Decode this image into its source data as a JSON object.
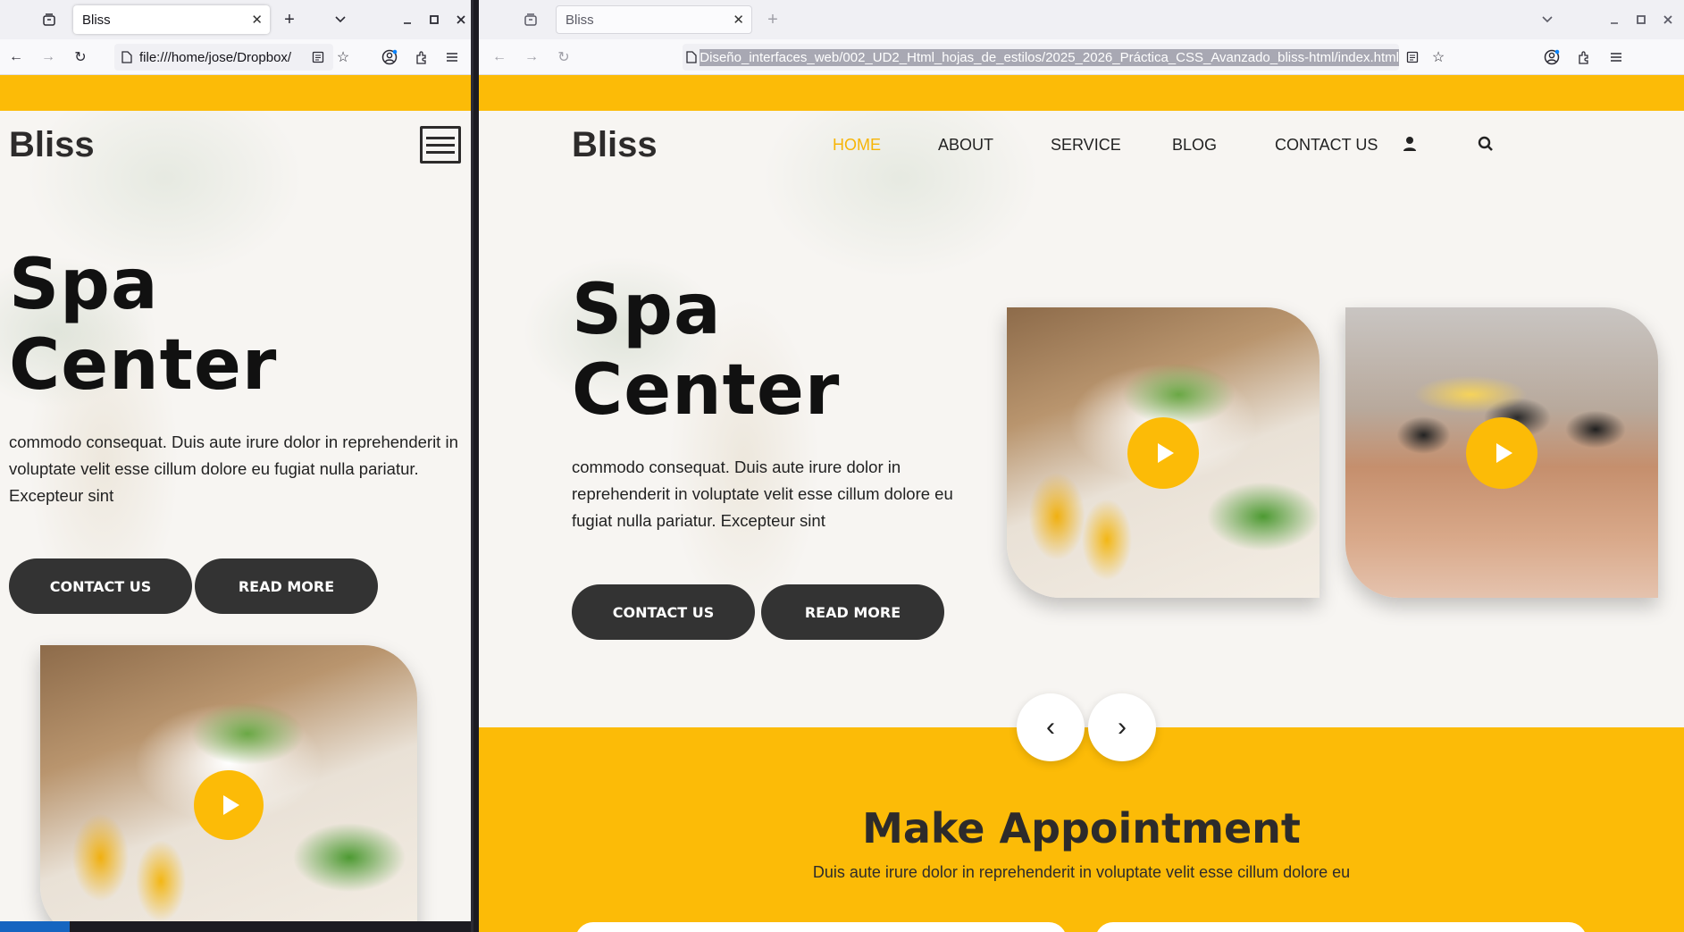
{
  "left_window": {
    "tab_title": "Bliss",
    "url": "file:///home/jose/Dropbox/",
    "logo": "Bliss",
    "hero_line1": "Spa",
    "hero_line2": "Center",
    "hero_text": "commodo consequat. Duis aute irure dolor in reprehenderit in voluptate velit esse cillum dolore eu fugiat nulla pariatur. Excepteur sint",
    "btn_contact": "CONTACT US",
    "btn_read": "READ MORE"
  },
  "right_window": {
    "tab_title": "Bliss",
    "url": "Diseño_interfaces_web/002_UD2_Html_hojas_de_estilos/2025_2026_Práctica_CSS_Avanzado_bliss-html/index.html",
    "logo": "Bliss",
    "nav": [
      "HOME",
      "ABOUT",
      "SERVICE",
      "BLOG",
      "CONTACT US"
    ],
    "hero_line1": "Spa",
    "hero_line2": "Center",
    "hero_text": "commodo consequat. Duis aute irure dolor in reprehenderit in voluptate velit esse cillum dolore eu fugiat nulla pariatur. Excepteur sint",
    "btn_contact": "CONTACT US",
    "btn_read": "READ MORE",
    "prev_arrow": "‹",
    "next_arrow": "›",
    "appointment_title": "Make Appointment",
    "appointment_subtitle": "Duis aute irure dolor in reprehenderit in voluptate velit esse cillum dolore eu"
  },
  "colors": {
    "accent": "#fcbb07",
    "dark_button": "#333333",
    "active_nav": "#f7b506"
  },
  "icons": [
    "tab-list-icon",
    "new-tab-icon",
    "tab-overflow-icon",
    "minimize-icon",
    "maximize-icon",
    "close-window-icon",
    "back-icon",
    "forward-icon",
    "reload-icon",
    "page-icon",
    "reader-mode-icon",
    "bookmark-star-icon",
    "account-icon",
    "extensions-icon",
    "menu-icon",
    "user-icon",
    "search-icon",
    "play-icon",
    "hamburger-icon"
  ]
}
